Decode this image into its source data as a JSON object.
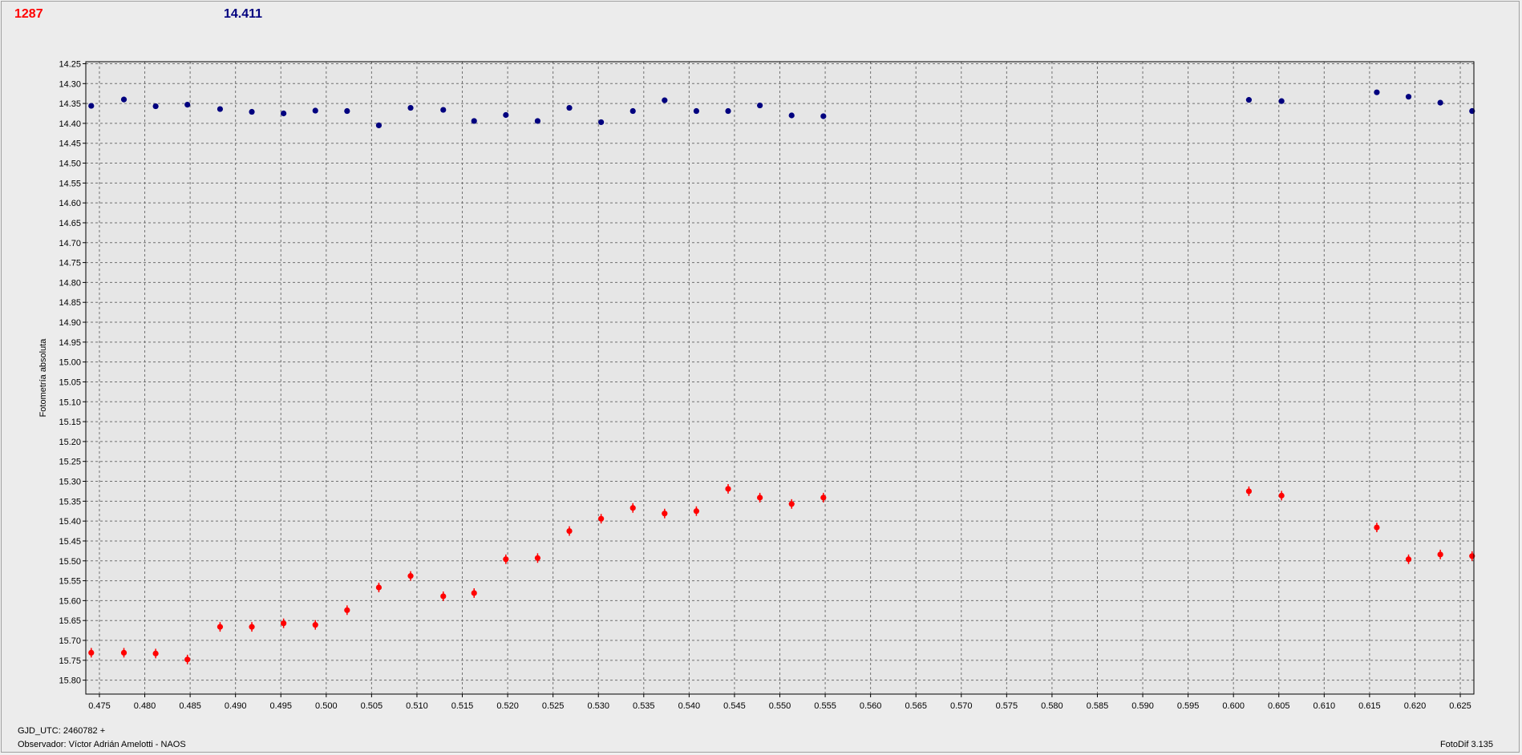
{
  "header": {
    "left_value": "1287",
    "right_value": "14.411"
  },
  "footer": {
    "gjd": "GJD_UTC: 2460782 +",
    "observer": "Observador: Víctor Adrián Amelotti - NAOS",
    "version": "FotoDif 3.135"
  },
  "colors": {
    "red_series": "#ff0000",
    "blue_series": "#00007f",
    "grid": "#707070",
    "plot_bg": "#e6e6e6"
  },
  "chart_data": {
    "type": "scatter",
    "ylabel": "Fotometría absoluta",
    "xlim": [
      0.4735,
      0.6265
    ],
    "ylim": [
      14.245,
      15.835
    ],
    "y_inverted": true,
    "grid": true,
    "x_ticks": [
      "0.475",
      "0.480",
      "0.485",
      "0.490",
      "0.495",
      "0.500",
      "0.505",
      "0.510",
      "0.515",
      "0.520",
      "0.525",
      "0.530",
      "0.535",
      "0.540",
      "0.545",
      "0.550",
      "0.555",
      "0.560",
      "0.565",
      "0.570",
      "0.575",
      "0.580",
      "0.585",
      "0.590",
      "0.595",
      "0.600",
      "0.605",
      "0.610",
      "0.615",
      "0.620",
      "0.625"
    ],
    "y_ticks": [
      "14.25",
      "14.30",
      "14.35",
      "14.40",
      "14.45",
      "14.50",
      "14.55",
      "14.60",
      "14.65",
      "14.70",
      "14.75",
      "14.80",
      "14.85",
      "14.90",
      "14.95",
      "15.00",
      "15.05",
      "15.10",
      "15.15",
      "15.20",
      "15.25",
      "15.30",
      "15.35",
      "15.40",
      "15.45",
      "15.50",
      "15.55",
      "15.60",
      "15.65",
      "15.70",
      "15.75",
      "15.80"
    ],
    "series": [
      {
        "color": "#ff0000",
        "error": 0.012,
        "x": [
          0.4741,
          0.4777,
          0.4812,
          0.4847,
          0.4883,
          0.4918,
          0.4953,
          0.4988,
          0.5023,
          0.5058,
          0.5093,
          0.5129,
          0.5163,
          0.5198,
          0.5233,
          0.5268,
          0.5303,
          0.5338,
          0.5373,
          0.5408,
          0.5443,
          0.5478,
          0.5513,
          0.5548,
          0.6017,
          0.6053,
          0.6158,
          0.6193,
          0.6228,
          0.6263
        ],
        "y": [
          15.731,
          15.731,
          15.733,
          15.748,
          15.666,
          15.666,
          15.657,
          15.661,
          15.624,
          15.567,
          15.538,
          15.589,
          15.581,
          15.496,
          15.493,
          15.425,
          15.394,
          15.367,
          15.381,
          15.375,
          15.319,
          15.341,
          15.357,
          15.341,
          15.325,
          15.336,
          15.416,
          15.496,
          15.484,
          15.488
        ]
      },
      {
        "color": "#00007f",
        "error": 0.004,
        "x": [
          0.4741,
          0.4777,
          0.4812,
          0.4847,
          0.4883,
          0.4918,
          0.4953,
          0.4988,
          0.5023,
          0.5058,
          0.5093,
          0.5129,
          0.5163,
          0.5198,
          0.5233,
          0.5268,
          0.5303,
          0.5338,
          0.5373,
          0.5408,
          0.5443,
          0.5478,
          0.5513,
          0.5548,
          0.6017,
          0.6053,
          0.6158,
          0.6193,
          0.6228,
          0.6263
        ],
        "y": [
          14.356,
          14.34,
          14.357,
          14.353,
          14.364,
          14.371,
          14.375,
          14.368,
          14.369,
          14.405,
          14.361,
          14.366,
          14.394,
          14.379,
          14.394,
          14.361,
          14.397,
          14.369,
          14.342,
          14.369,
          14.369,
          14.355,
          14.38,
          14.382,
          14.341,
          14.344,
          14.322,
          14.333,
          14.348,
          14.369
        ]
      }
    ]
  }
}
